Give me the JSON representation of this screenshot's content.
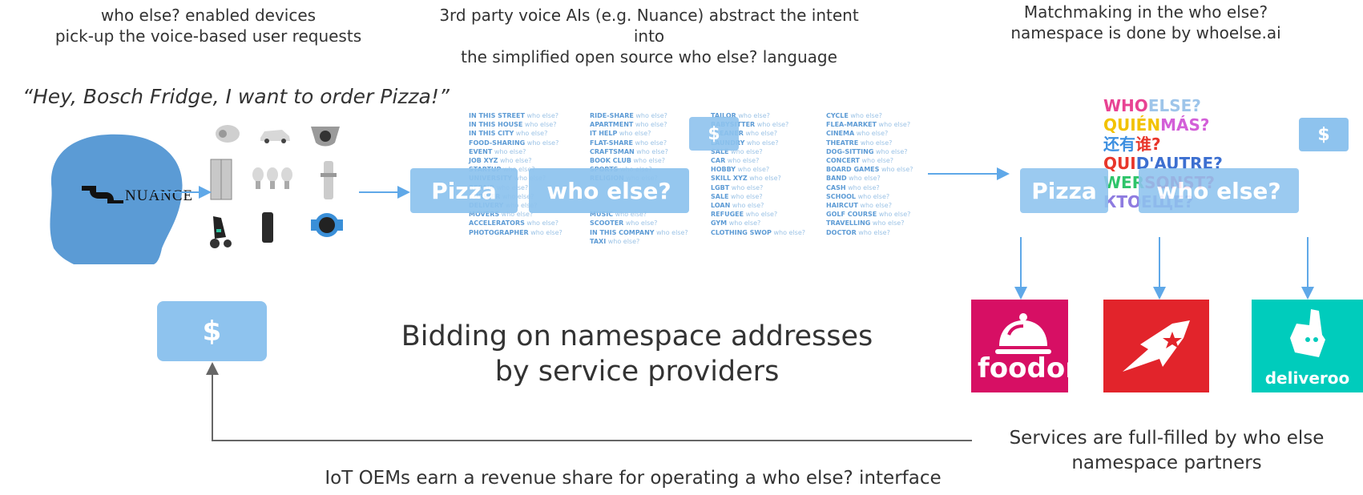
{
  "captions": {
    "devices": "who else? enabled devices\npick-up the voice-based user requests",
    "voice_ai": "3rd party voice AIs (e.g. Nuance) abstract the intent into\nthe simplified open source who else? language",
    "matchmaking": "Matchmaking in the who else?\nnamespace is done by whoelse.ai",
    "quote": "“Hey, Bosch Fridge, I want to order Pizza!”",
    "bidding": "Bidding on namespace addresses\nby service providers",
    "services": "Services are full-filled by who else\nnamespace partners",
    "iot": "IoT OEMs earn a revenue share for operating a who else? interface"
  },
  "nuance_logo": "NUANCE",
  "intent_left": {
    "pizza": "Pizza",
    "who_else": "who else?"
  },
  "intent_right": {
    "pizza": "Pizza",
    "who_else": "who else?"
  },
  "dollar": "$",
  "namespace_columns": [
    [
      {
        "b": "IN THIS STREET",
        "n": "who else?"
      },
      {
        "b": "IN THIS HOUSE",
        "n": "who else?"
      },
      {
        "b": "IN THIS CITY",
        "n": "who else?"
      },
      {
        "b": "FOOD-SHARING",
        "n": "who else?"
      },
      {
        "b": "EVENT",
        "n": "who else?"
      },
      {
        "b": "JOB XYZ",
        "n": "who else?"
      },
      {
        "b": "STARTUP",
        "n": "who else?"
      },
      {
        "b": "UNIVERSITY",
        "n": "who else?"
      },
      {
        "b": "REPAIR",
        "n": "who else?"
      },
      {
        "b": "CURRIER",
        "n": "who else?"
      },
      {
        "b": "DELIVERY",
        "n": "who else?"
      },
      {
        "b": "MOVERS",
        "n": "who else?"
      },
      {
        "b": "ACCELERATORS",
        "n": "who else?"
      },
      {
        "b": "PHOTOGRAPHER",
        "n": "who else?"
      }
    ],
    [
      {
        "b": "RIDE-SHARE",
        "n": "who else?"
      },
      {
        "b": "APARTMENT",
        "n": "who else?"
      },
      {
        "b": "IT HELP",
        "n": "who else?"
      },
      {
        "b": "FLAT-SHARE",
        "n": "who else?"
      },
      {
        "b": "CRAFTSMAN",
        "n": "who else?"
      },
      {
        "b": "BOOK CLUB",
        "n": "who else?"
      },
      {
        "b": "SPORTS",
        "n": "who else?"
      },
      {
        "b": "RELIGION",
        "n": "who else?"
      },
      {
        "b": "",
        "n": ""
      },
      {
        "b": "",
        "n": ""
      },
      {
        "b": "",
        "n": ""
      },
      {
        "b": "MUSIC",
        "n": "who else?"
      },
      {
        "b": "SCOOTER",
        "n": "who else?"
      },
      {
        "b": "IN THIS COMPANY",
        "n": "who else?"
      },
      {
        "b": "TAXI",
        "n": "who else?"
      }
    ],
    [
      {
        "b": "TAILOR",
        "n": "who else?"
      },
      {
        "b": "BABYSITTER",
        "n": "who else?"
      },
      {
        "b": "CLEANER",
        "n": "who else?"
      },
      {
        "b": "LAUNDRY",
        "n": "who else?"
      },
      {
        "b": "SALE",
        "n": "who else?"
      },
      {
        "b": "CAR",
        "n": "who else?"
      },
      {
        "b": "HOBBY",
        "n": "who else?"
      },
      {
        "b": "SKILL XYZ",
        "n": "who else?"
      },
      {
        "b": "LGBT",
        "n": "who else?"
      },
      {
        "b": "SALE",
        "n": "who else?"
      },
      {
        "b": "LOAN",
        "n": "who else?"
      },
      {
        "b": "REFUGEE",
        "n": "who else?"
      },
      {
        "b": "GYM",
        "n": "who else?"
      },
      {
        "b": "CLOTHING SWOP",
        "n": "who else?"
      }
    ],
    [
      {
        "b": "CYCLE",
        "n": "who else?"
      },
      {
        "b": "FLEA-MARKET",
        "n": "who else?"
      },
      {
        "b": "CINEMA",
        "n": "who else?"
      },
      {
        "b": "THEATRE",
        "n": "who else?"
      },
      {
        "b": "DOG-SITTING",
        "n": "who else?"
      },
      {
        "b": "CONCERT",
        "n": "who else?"
      },
      {
        "b": "BOARD GAMES",
        "n": "who else?"
      },
      {
        "b": "BAND",
        "n": "who else?"
      },
      {
        "b": "CASH",
        "n": "who else?"
      },
      {
        "b": "SCHOOL",
        "n": "who else?"
      },
      {
        "b": "HAIRCUT",
        "n": "who else?"
      },
      {
        "b": "GOLF COURSE",
        "n": "who else?"
      },
      {
        "b": "TRAVELLING",
        "n": "who else?"
      },
      {
        "b": "DOCTOR",
        "n": "who else?"
      }
    ]
  ],
  "languages": [
    {
      "a": "WHO",
      "b": "ELSE?",
      "ca": "#e84393",
      "cb": "#9ec5ea"
    },
    {
      "a": "QUIÉN",
      "b": "MÁS?",
      "ca": "#f2c200",
      "cb": "#d35fd8"
    },
    {
      "a": "还有",
      "b": "谁?",
      "ca": "#3c8fe0",
      "cb": "#e8362a"
    },
    {
      "a": "QUI",
      "b": "D'AUTRE?",
      "ca": "#e8362a",
      "cb": "#3c6fd0"
    },
    {
      "a": "WER",
      "b": "SONST?",
      "ca": "#2ec46a",
      "cb": "#e84393"
    },
    {
      "a": "КТО",
      "b": "ЕЩЕ?",
      "ca": "#8e7be0",
      "cb": "#8e7be0"
    }
  ],
  "partners": {
    "foodora": {
      "label": "foodora",
      "color": "#d70f64"
    },
    "lieferando": {
      "label": "",
      "color": "#e2242b"
    },
    "deliveroo": {
      "label": "deliveroo",
      "color": "#00ccbc"
    }
  },
  "colors": {
    "accent": "#8ec3ee",
    "arrow": "#5fa8e8",
    "head": "#5b9bd5"
  }
}
